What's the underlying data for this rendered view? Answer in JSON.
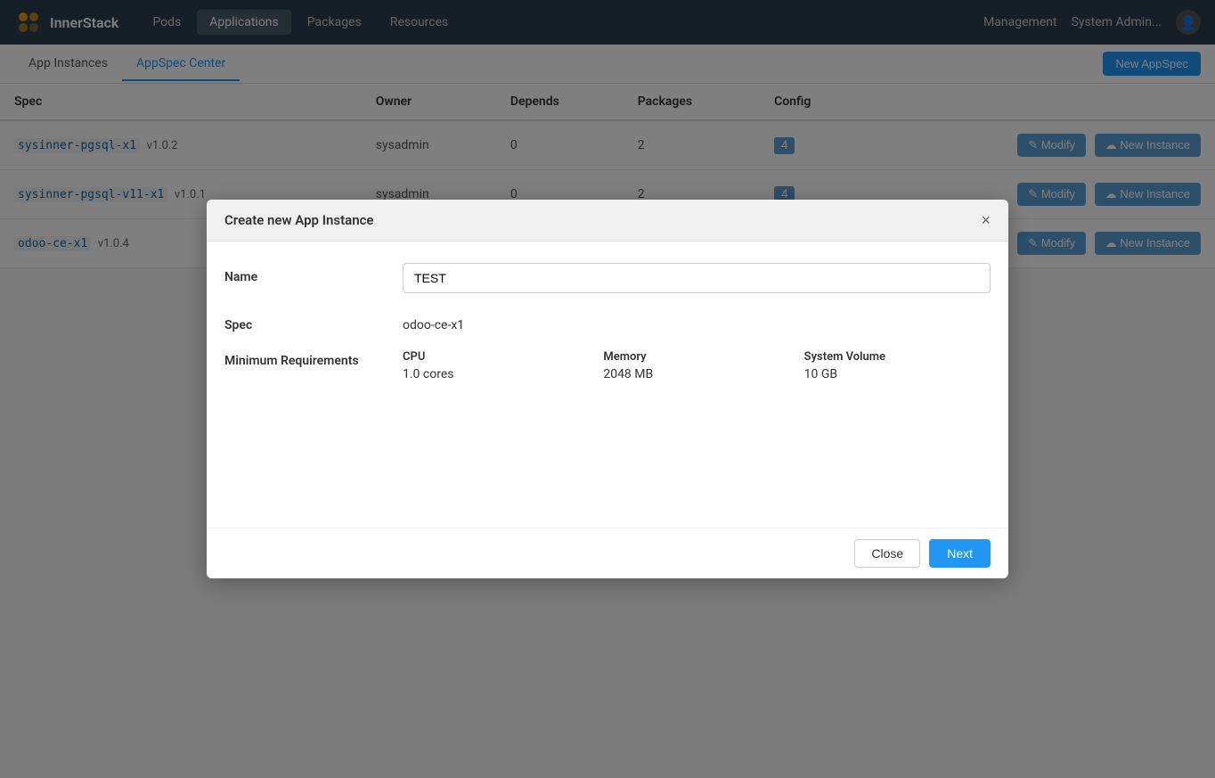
{
  "navbar": {
    "brand": "InnerStack",
    "nav_items": [
      {
        "label": "Pods",
        "active": false
      },
      {
        "label": "Applications",
        "active": true
      },
      {
        "label": "Packages",
        "active": false
      },
      {
        "label": "Resources",
        "active": false
      }
    ],
    "management_label": "Management",
    "admin_label": "System Admin...",
    "user_icon": "👤"
  },
  "subnav": {
    "tabs": [
      {
        "label": "App Instances",
        "active": false
      },
      {
        "label": "AppSpec Center",
        "active": true
      }
    ],
    "new_appspec_label": "New AppSpec"
  },
  "table": {
    "columns": [
      "Spec",
      "Owner",
      "Depends",
      "Packages",
      "Config"
    ],
    "rows": [
      {
        "spec_code": "sysinner-pgsql-x1",
        "version": "v1.0.2",
        "owner": "sysadmin",
        "depends": "0",
        "packages": "2",
        "config": "4",
        "modify_label": "Modify",
        "new_instance_label": "New Instance"
      },
      {
        "spec_code": "sysinner-pgsql-v11-x1",
        "version": "v1.0.1",
        "owner": "sysadmin",
        "depends": "0",
        "packages": "2",
        "config": "4",
        "modify_label": "Modify",
        "new_instance_label": "New Instance"
      },
      {
        "spec_code": "odoo-ce-x1",
        "version": "v1.0.4",
        "owner": "",
        "depends": "",
        "packages": "",
        "config": "",
        "modify_label": "Modify",
        "new_instance_label": "New Instance"
      }
    ]
  },
  "modal": {
    "title": "Create new App Instance",
    "close_label": "×",
    "name_label": "Name",
    "name_value": "TEST",
    "name_placeholder": "TEST",
    "spec_label": "Spec",
    "spec_value": "odoo-ce-x1",
    "min_req_label": "Minimum Requirements",
    "cpu_label": "CPU",
    "cpu_value": "1.0 cores",
    "memory_label": "Memory",
    "memory_value": "2048 MB",
    "system_volume_label": "System Volume",
    "system_volume_value": "10 GB",
    "close_button_label": "Close",
    "next_button_label": "Next"
  }
}
